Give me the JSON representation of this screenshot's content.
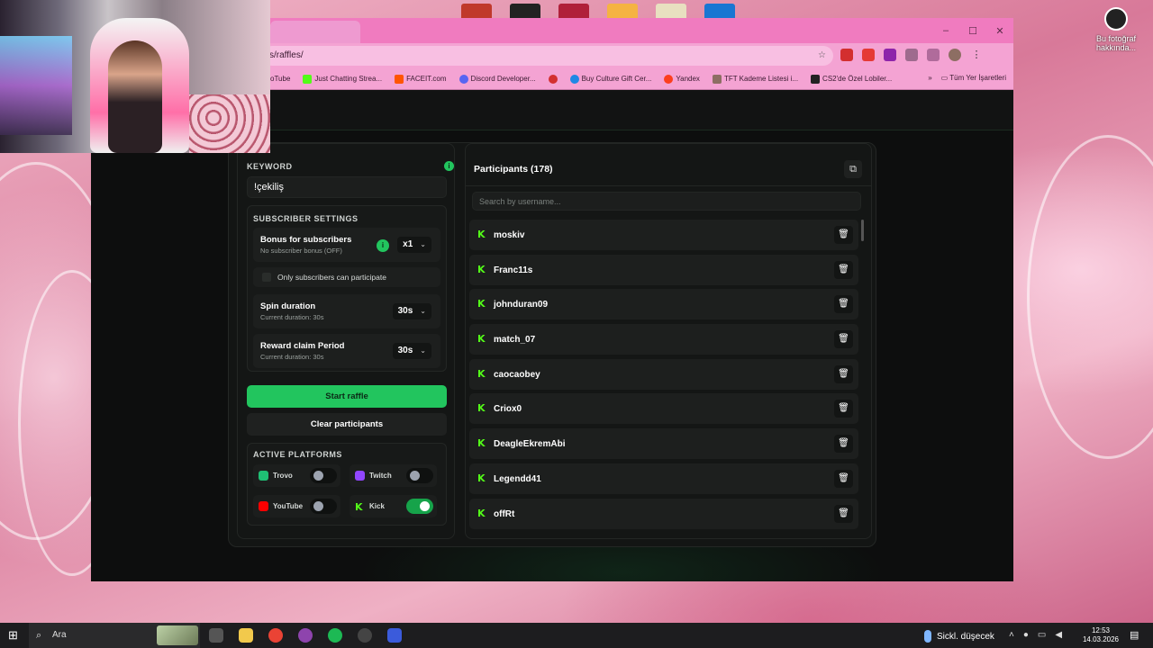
{
  "desktop": {
    "icon_label": "Bu fotoğraf hakkında..."
  },
  "browser": {
    "url": "s/raffles/",
    "window_buttons": [
      "–",
      "☐",
      "✕"
    ],
    "bookmarks": [
      {
        "label": "oTube",
        "color": "#ffffff"
      },
      {
        "label": "Just Chatting Strea...",
        "color": "#53fc18"
      },
      {
        "label": "FACEIT.com",
        "color": "#ff5500"
      },
      {
        "label": "Discord Developer...",
        "color": "#5865f2"
      },
      {
        "label": "",
        "color": "#d32f2f"
      },
      {
        "label": "Buy Culture Gift Cer...",
        "color": "#1e88e5"
      },
      {
        "label": "Yandex",
        "color": "#fc3f1d"
      },
      {
        "label": "TFT Kademe Listesi i...",
        "color": "#8d6e63"
      },
      {
        "label": "CS2'de Özel Lobiler...",
        "color": "#222222"
      }
    ],
    "bookmarks_more": "»",
    "all_bookmarks": "Tüm Yer İşaretleri"
  },
  "raffle": {
    "keyword_label": "KEYWORD",
    "keyword_value": "!çekiliş",
    "subscriber_settings_title": "SUBSCRIBER SETTINGS",
    "bonus": {
      "title": "Bonus for subscribers",
      "subtitle": "No subscriber bonus (OFF)",
      "value": "x1"
    },
    "only_subs_label": "Only subscribers can participate",
    "spin": {
      "title": "Spin duration",
      "subtitle": "Current duration: 30s",
      "value": "30s"
    },
    "reward": {
      "title": "Reward claim Period",
      "subtitle": "Current duration: 30s",
      "value": "30s"
    },
    "start_button": "Start raffle",
    "clear_button": "Clear participants",
    "active_platforms_title": "ACTIVE PLATFORMS",
    "platforms": [
      {
        "name": "Trovo",
        "enabled": false,
        "color": "#1fbf74"
      },
      {
        "name": "Twitch",
        "enabled": false,
        "color": "#9146ff"
      },
      {
        "name": "YouTube",
        "enabled": false,
        "color": "#ff0000"
      },
      {
        "name": "Kick",
        "enabled": true,
        "color": "#53fc18"
      }
    ]
  },
  "participants": {
    "title": "Participants (178)",
    "search_placeholder": "Search by username...",
    "list": [
      "moskiv",
      "Franc11s",
      "johnduran09",
      "match_07",
      "caocaobey",
      "Criox0",
      "DeagleEkremAbi",
      "Legendd41",
      "offRt"
    ]
  },
  "taskbar": {
    "search_label": "Ara",
    "weather": "Sickl. düşecek",
    "time": "12:53",
    "date": "14.03.2026"
  },
  "colors": {
    "accent": "#22c55e",
    "kick": "#53fc18",
    "browser_frame": "#f07bbf"
  }
}
